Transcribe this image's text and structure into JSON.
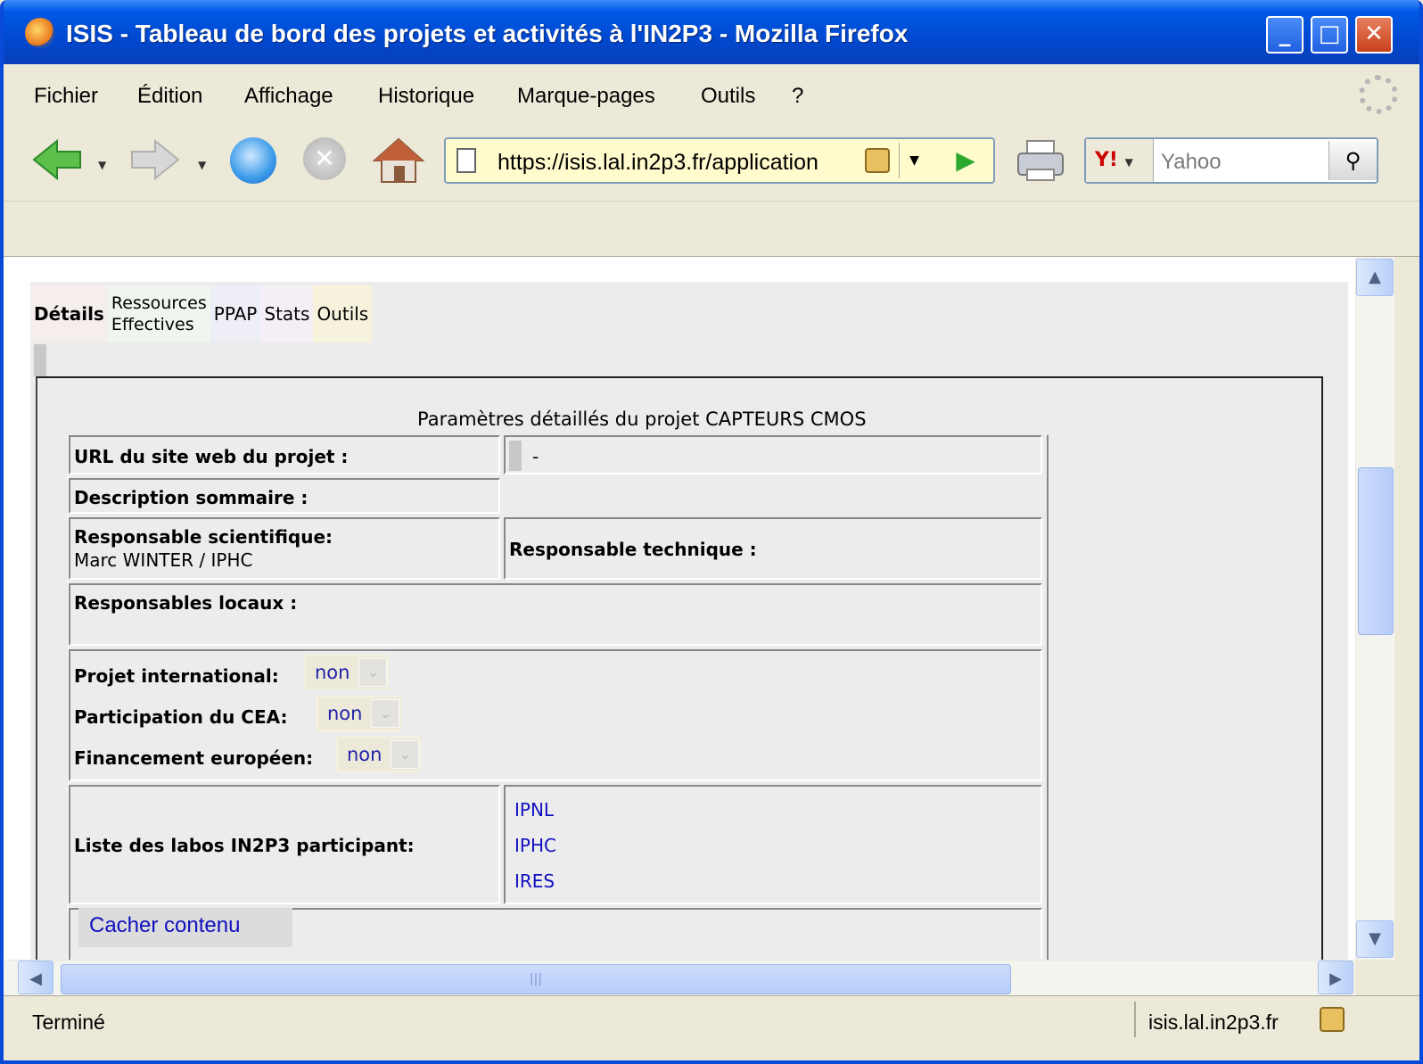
{
  "window": {
    "title": "ISIS - Tableau de bord des projets et activités à l'IN2P3 - Mozilla Firefox",
    "minimize": "_",
    "maximize": "□",
    "close": "✕"
  },
  "menu": {
    "items": [
      "Fichier",
      "Édition",
      "Affichage",
      "Historique",
      "Marque-pages",
      "Outils",
      "?"
    ]
  },
  "toolbar": {
    "url": "https://isis.lal.in2p3.fr/application",
    "search_engine": "Y!",
    "search_placeholder": "Yahoo"
  },
  "tabs": {
    "details": "Détails",
    "ressources_line1": "Ressources",
    "ressources_line2": "Effectives",
    "ppap": "PPAP",
    "stats": "Stats",
    "outils": "Outils"
  },
  "panel": {
    "title": "Paramètres détaillés du projet CAPTEURS CMOS",
    "url_label": "URL du site web du projet :",
    "url_value": "-",
    "description_label": "Description sommaire :",
    "resp_sci_label": "Responsable scientifique:",
    "resp_sci_value": "Marc WINTER / IPHC",
    "resp_tech_label": "Responsable technique :",
    "resp_locaux_label": "Responsables locaux :",
    "intl_label": "Projet international:",
    "intl_value": "non",
    "cea_label": "Participation du CEA:",
    "cea_value": "non",
    "euro_label": "Financement européen:",
    "euro_value": "non",
    "labs_label": "Liste des labos IN2P3 participant:",
    "labs": [
      "IPNL",
      "IPHC",
      "IRES"
    ],
    "hide_button": "Cacher contenu"
  },
  "status": {
    "text": "Terminé",
    "host": "isis.lal.in2p3.fr"
  },
  "colors": {
    "titlebar": "#0058e6",
    "link": "#1010c0",
    "chrome": "#ece9d8"
  }
}
